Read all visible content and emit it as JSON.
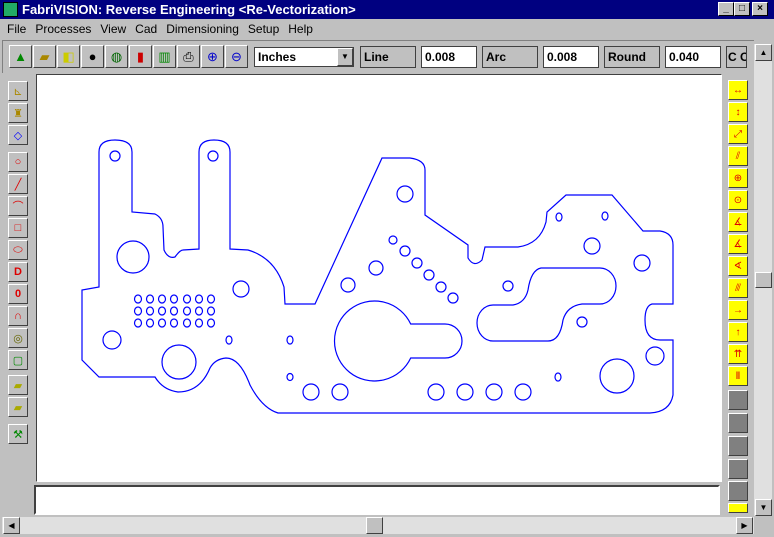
{
  "window": {
    "title": "FabriVISION: Reverse Engineering <Re-Vectorization>",
    "minimize": "_",
    "maximize": "□",
    "close": "×"
  },
  "menu": [
    "File",
    "Processes",
    "View",
    "Cad",
    "Dimensioning",
    "Setup",
    "Help"
  ],
  "toolbar": {
    "icons": [
      "triangle-tool-icon",
      "open-folder-icon",
      "copy-icon",
      "dark-circle-icon",
      "scanner-icon",
      "bar-chart-color-icon",
      "bar-chart-icon",
      "printer-icon",
      "zoom-in-icon",
      "zoom-out-icon"
    ],
    "units": "Inches",
    "line_label": "Line",
    "line_value": "0.008",
    "arc_label": "Arc",
    "arc_value": "0.008",
    "round_label": "Round",
    "round_value": "0.040",
    "cc_label": "C C"
  },
  "left_tools": [
    "axis-tool",
    "brush-tool",
    "diamond-tool",
    "circle-tool",
    "line-tool",
    "arc-tool",
    "rectangle-tool",
    "slot-tool",
    "d-shape-tool",
    "double-d-tool",
    "arch-tool",
    "ring-tool",
    "box-points-tool",
    "eraser-tool",
    "eraser-points-tool",
    "hammer-tool"
  ],
  "right_tools": [
    "horizontal-dimension",
    "vertical-dimension",
    "aligned-dimension",
    "parallel-dimension",
    "diameter-dimension",
    "radius-dimension",
    "angle-dimension-1",
    "angle-dimension-2",
    "angle-dimension-3",
    "chamfer-dimension",
    "baseline-horizontal",
    "baseline-vertical",
    "ordinate-dimension",
    "profile-dimension",
    "disabled-1",
    "disabled-2",
    "disabled-3",
    "disabled-4",
    "disabled-5",
    "car-dimension"
  ],
  "colors": {
    "titlebar": "#000080",
    "drawing": "#0000ff",
    "tool_yellow": "#ffff00"
  }
}
